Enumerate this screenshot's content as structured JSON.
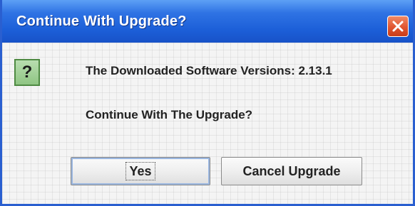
{
  "dialog": {
    "title": "Continue With Upgrade?",
    "close_icon": "close-icon",
    "question_icon": "question-mark-icon",
    "question_glyph": "?",
    "message_line1": "The Downloaded Software Versions: 2.13.1",
    "message_line2": "Continue With The Upgrade?",
    "yes_label": "Yes",
    "cancel_label": "Cancel Upgrade"
  },
  "colors": {
    "titlebar": "#1c5fd8",
    "close_button": "#e05530",
    "icon_fill": "#8fc583"
  }
}
